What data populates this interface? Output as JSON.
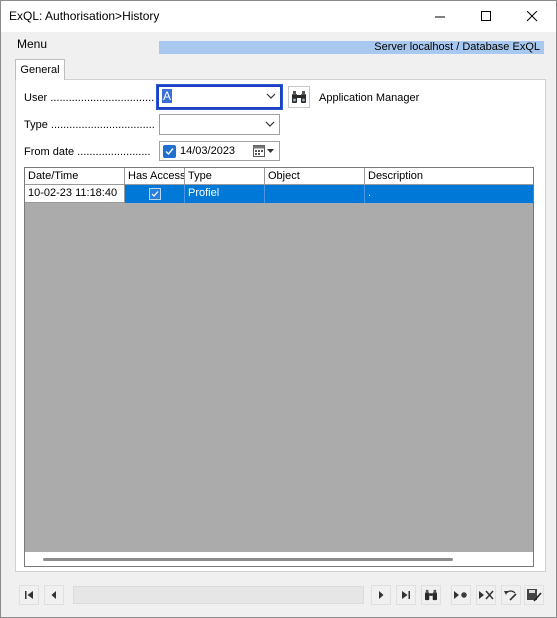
{
  "window": {
    "title": "ExQL: Authorisation>History",
    "minimize_icon": "minimize-icon",
    "maximize_icon": "maximize-icon",
    "close_icon": "close-icon"
  },
  "menu": {
    "label": "Menu"
  },
  "server_info": "Server localhost / Database ExQL",
  "tabs": [
    {
      "label": "General"
    }
  ],
  "form": {
    "user": {
      "label": "User ..................................",
      "value": "A",
      "description": "Application Manager"
    },
    "type": {
      "label": "Type ..................................",
      "value": ""
    },
    "from_date": {
      "label": "From date ........................",
      "checked": true,
      "value": "14/03/2023"
    }
  },
  "grid": {
    "columns": [
      "Date/Time",
      "Has Access",
      "Type",
      "Object",
      "Description"
    ],
    "rows": [
      {
        "datetime": "10-02-23 11:18:40",
        "has_access": true,
        "type": "Profiel",
        "object": "",
        "description": "."
      }
    ]
  },
  "colors": {
    "accent": "#0078d7",
    "server_bar": "#a9c8ef",
    "grid_background": "#ababab",
    "focus_border": "#1e3fbf"
  }
}
